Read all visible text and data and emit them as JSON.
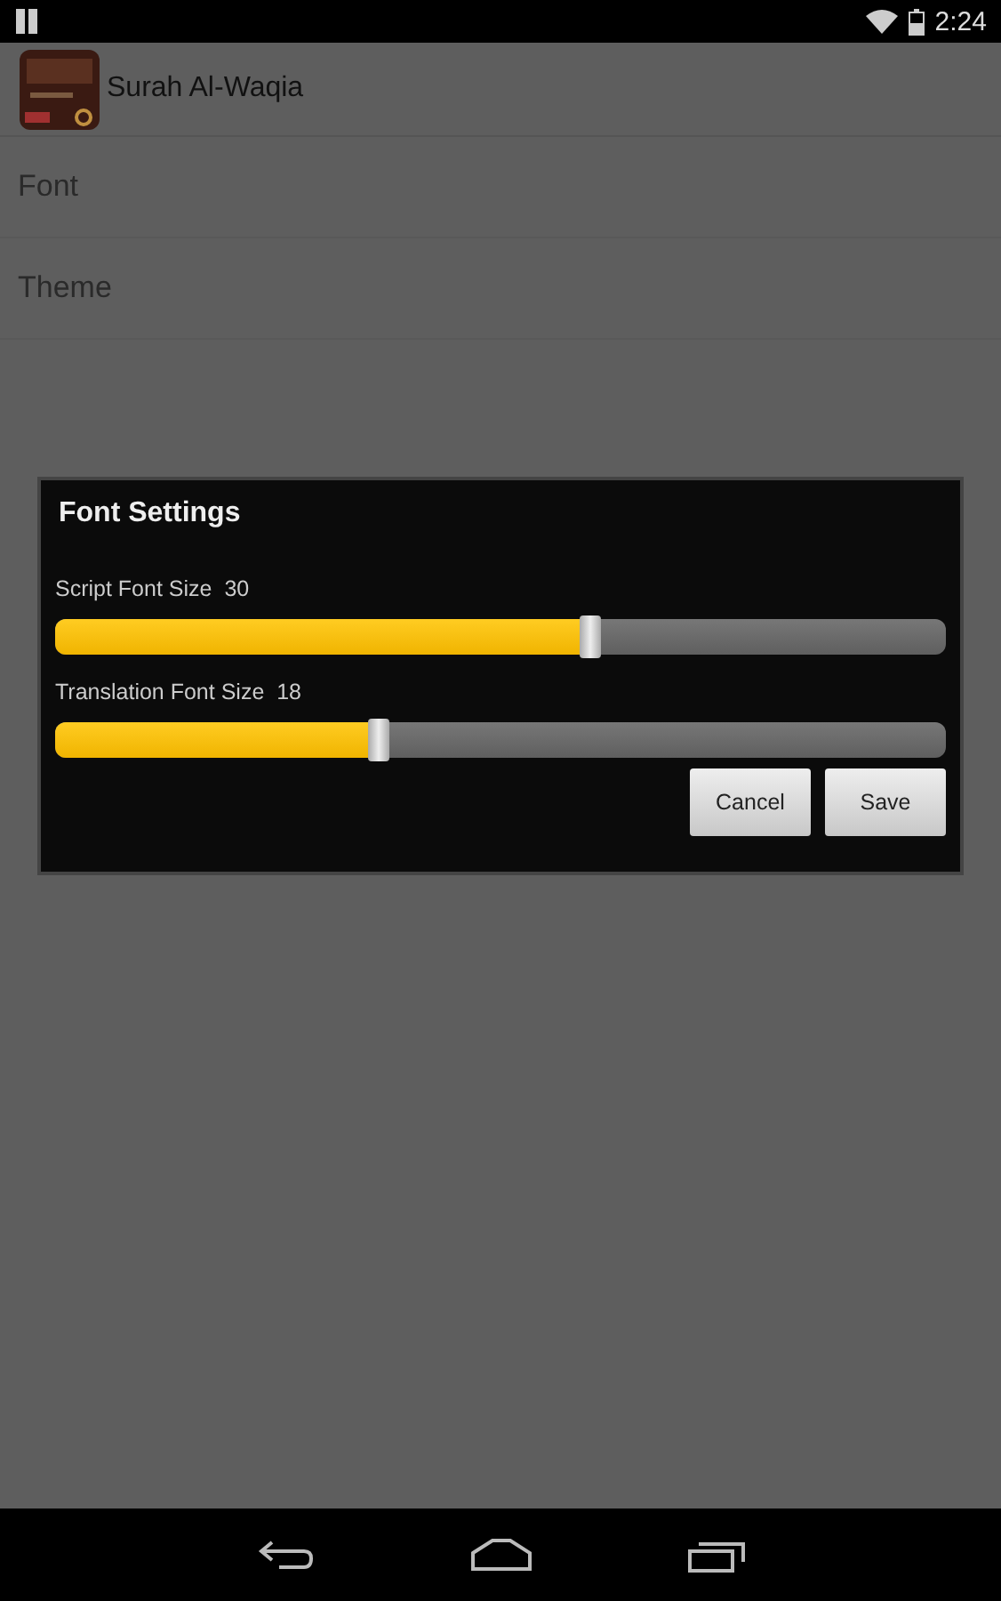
{
  "status_bar": {
    "time": "2:24"
  },
  "action_bar": {
    "title": "Surah Al-Waqia"
  },
  "settings_items": [
    {
      "label": "Font"
    },
    {
      "label": "Theme"
    }
  ],
  "dialog": {
    "title": "Font Settings",
    "sliders": [
      {
        "label": "Script Font Size",
        "reading": "30",
        "level": 0.6
      },
      {
        "label": "Translation Font Size",
        "reading": "18",
        "level": 0.364
      }
    ],
    "buttons": [
      "Cancel",
      "Save"
    ]
  }
}
